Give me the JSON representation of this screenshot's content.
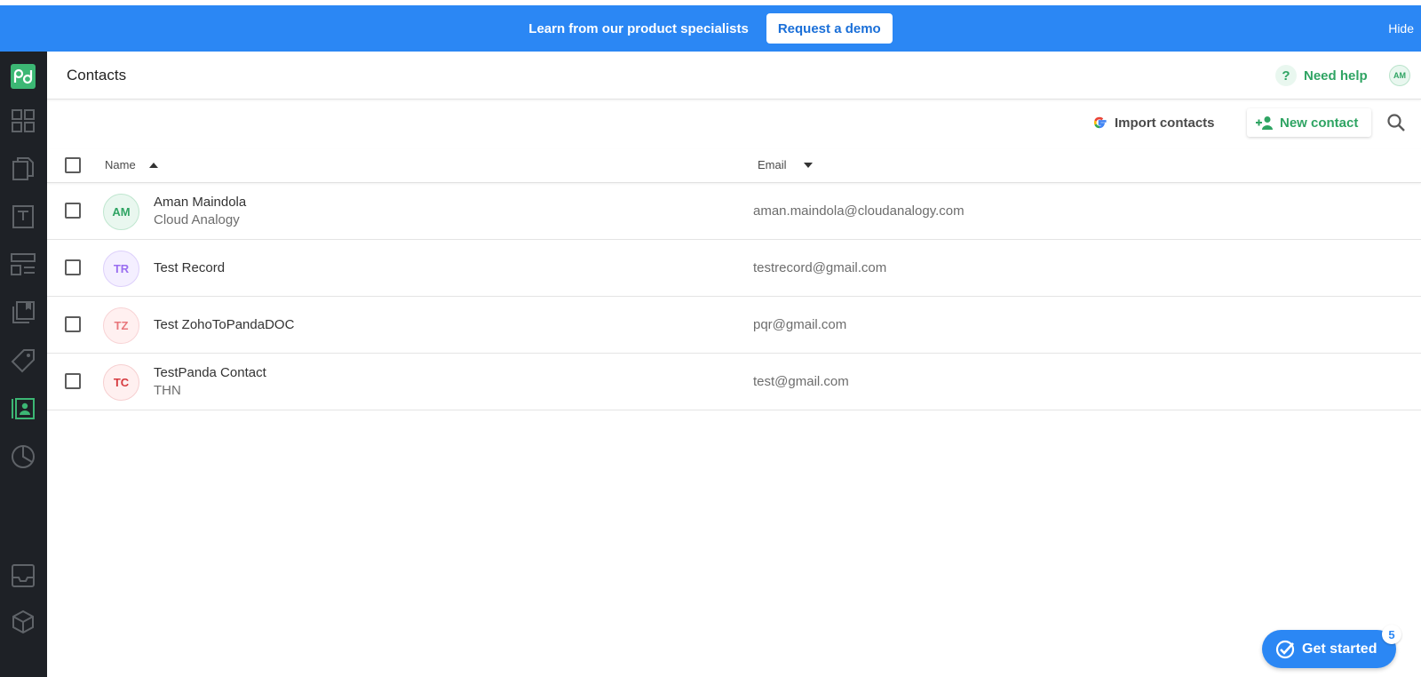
{
  "banner": {
    "text": "Learn from our product specialists",
    "demo_button": "Request a demo",
    "hide": "Hide"
  },
  "sidebar": {
    "logo": "pd",
    "items": [
      {
        "icon": "dashboard-icon"
      },
      {
        "icon": "documents-icon"
      },
      {
        "icon": "templates-icon"
      },
      {
        "icon": "forms-icon"
      },
      {
        "icon": "content-library-icon"
      },
      {
        "icon": "catalog-icon"
      },
      {
        "icon": "contacts-icon",
        "active": true
      },
      {
        "icon": "reports-icon"
      },
      {
        "icon": "inbox-icon"
      },
      {
        "icon": "integrations-icon"
      }
    ]
  },
  "header": {
    "title": "Contacts",
    "help_label": "Need help",
    "avatar_initials": "AM"
  },
  "toolbar": {
    "import_label": "Import contacts",
    "new_contact_label": "New contact"
  },
  "table": {
    "columns": {
      "name": "Name",
      "email": "Email"
    },
    "rows": [
      {
        "initials": "AM",
        "name": "Aman Maindola",
        "company": "Cloud Analogy",
        "email": "aman.maindola@cloudanalogy.com",
        "avatar_bg": "#e9f7ef",
        "avatar_fg": "#2fa463",
        "avatar_border": "#bfe6cf"
      },
      {
        "initials": "TR",
        "name": "Test Record",
        "company": "",
        "email": "testrecord@gmail.com",
        "avatar_bg": "#f4efff",
        "avatar_fg": "#9a6ef0",
        "avatar_border": "#ddd0fb"
      },
      {
        "initials": "TZ",
        "name": "Test ZohoToPandaDOC",
        "company": "",
        "email": "pqr@gmail.com",
        "avatar_bg": "#fff0f0",
        "avatar_fg": "#e8767b",
        "avatar_border": "#f8d3d5"
      },
      {
        "initials": "TC",
        "name": "TestPanda Contact",
        "company": "THN",
        "email": "test@gmail.com",
        "avatar_bg": "#fff0f0",
        "avatar_fg": "#d63a3f",
        "avatar_border": "#f6cfd0"
      }
    ]
  },
  "get_started": {
    "label": "Get started",
    "badge": "5"
  },
  "colors": {
    "accent_blue": "#2b87f4",
    "brand_green": "#2fa463",
    "sidebar_bg": "#1e2126"
  }
}
